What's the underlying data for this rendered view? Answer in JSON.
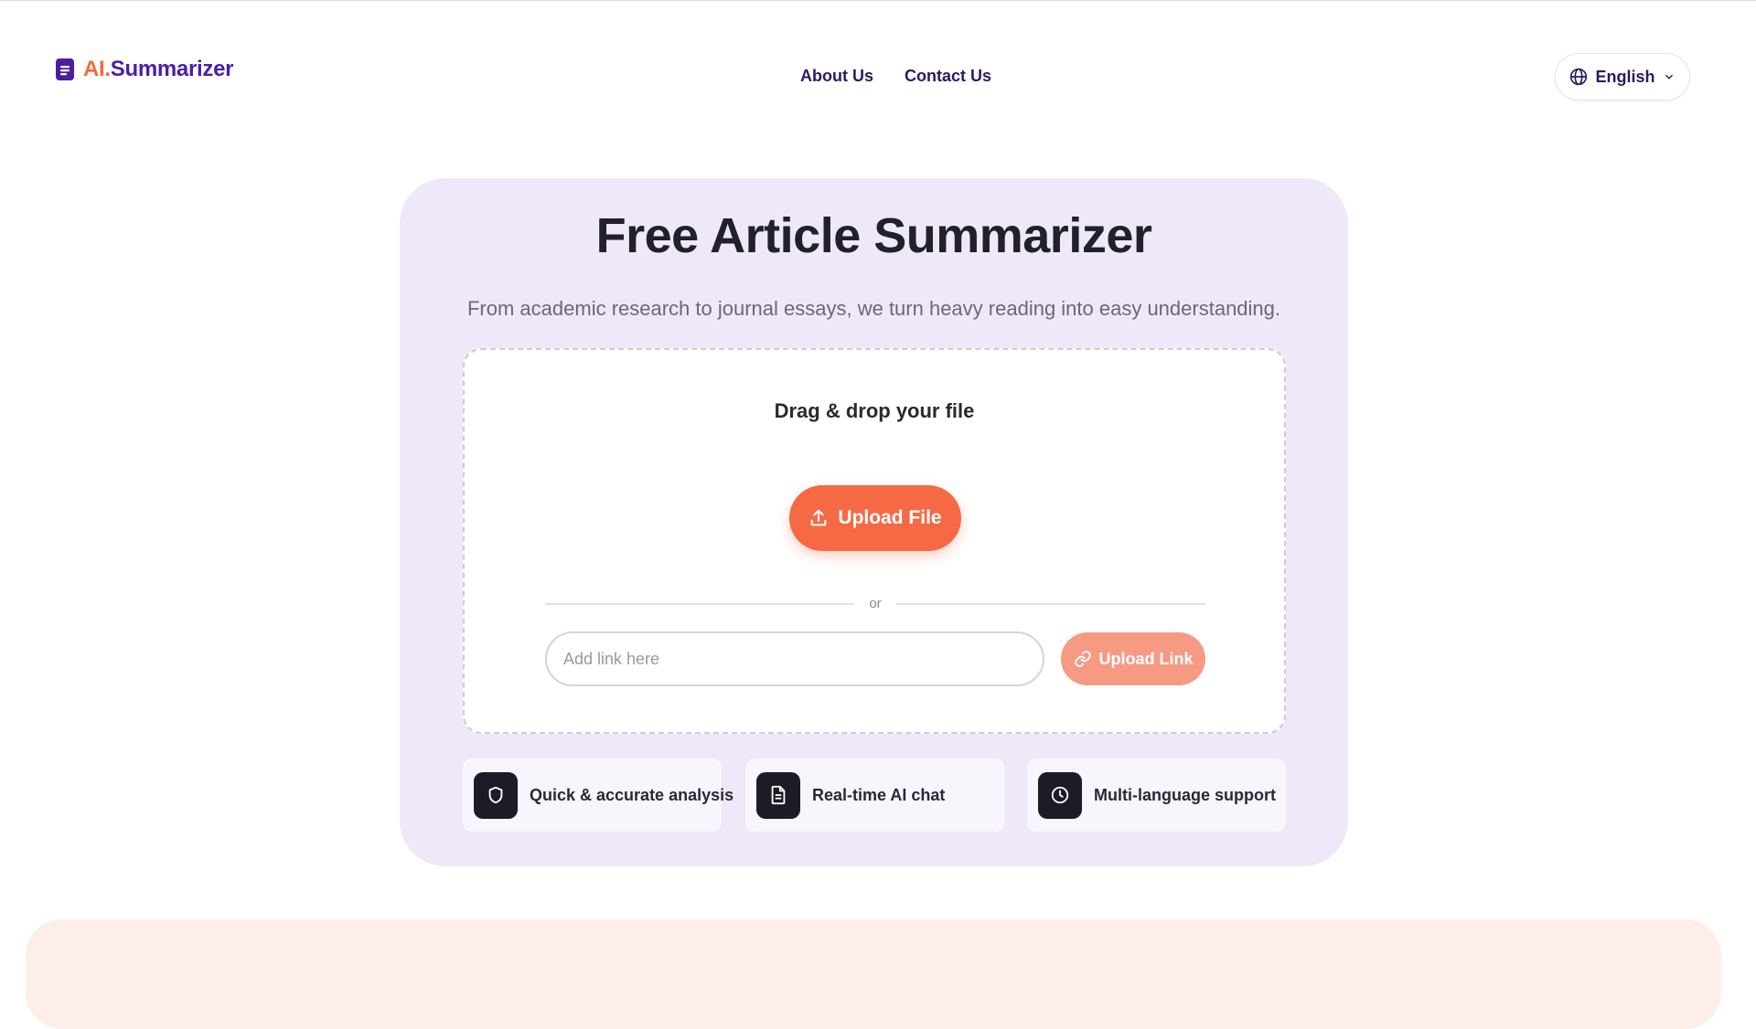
{
  "header": {
    "logo": {
      "ai": "AI.",
      "rest": "Summarizer"
    },
    "nav": [
      {
        "label": "About Us"
      },
      {
        "label": "Contact Us"
      }
    ],
    "language": {
      "label": "English",
      "icon": "globe-icon"
    }
  },
  "hero": {
    "title": "Free Article Summarizer",
    "subtitle": "From academic research to journal essays, we turn heavy reading into easy understanding.",
    "dropzone": {
      "label": "Drag & drop your file",
      "upload_file_label": "Upload File",
      "divider_text": "or",
      "link_placeholder": "Add link here",
      "upload_link_label": "Upload Link"
    },
    "features": [
      {
        "label": "Quick & accurate analysis",
        "icon": "shield-icon"
      },
      {
        "label": "Real-time AI chat",
        "icon": "document-icon"
      },
      {
        "label": "Multi-language support",
        "icon": "clock-icon"
      }
    ]
  },
  "colors": {
    "brand_orange": "#f56a45",
    "brand_purple": "#4a1fa3",
    "hero_bg": "#efe8f8",
    "bottom_band": "#fdeee9"
  }
}
